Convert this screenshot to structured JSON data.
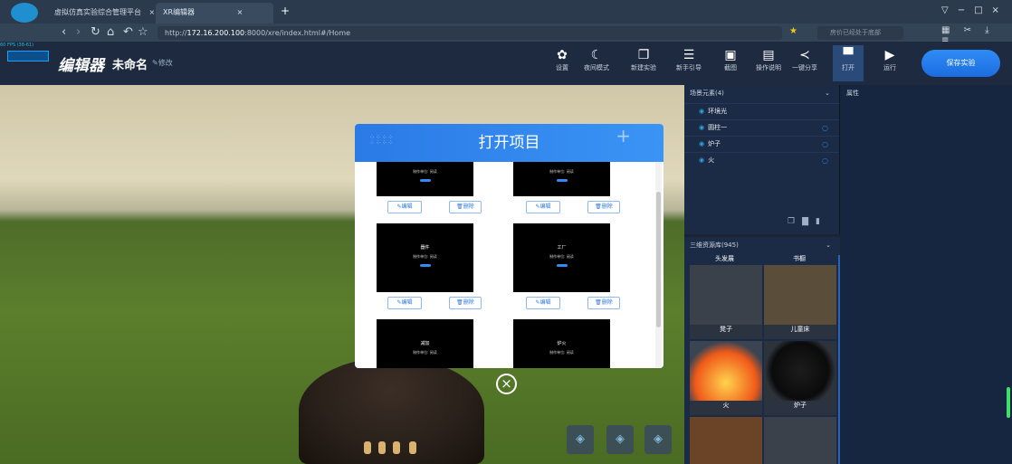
{
  "browser": {
    "tabs": [
      {
        "label": "虚拟仿真实验综合管理平台",
        "close": "×"
      },
      {
        "label": "XR编辑器",
        "close": "×"
      }
    ],
    "new_tab": "+",
    "window_controls": [
      "▽",
      "−",
      "□",
      "×"
    ],
    "url_prefix": "http://",
    "url_host": "172.16.200.100",
    "url_rest": ":8000/xre/index.html#/Home",
    "search_placeholder": "房价已经处于底部"
  },
  "app": {
    "fps": "60 FPS (38-61)",
    "logo": "编辑器",
    "project_name": "未命名",
    "modify_label": "修改",
    "toolbar": [
      {
        "label": "设置",
        "icon": "gear-icon"
      },
      {
        "label": "夜间模式",
        "icon": "moon-icon"
      },
      {
        "label": "新建实验",
        "icon": "new-icon"
      },
      {
        "label": "新手引导",
        "icon": "guide-icon"
      },
      {
        "label": "截图",
        "icon": "image-icon"
      },
      {
        "label": "操作说明",
        "icon": "doc-icon"
      },
      {
        "label": "一键分享",
        "icon": "share-icon"
      },
      {
        "label": "打开",
        "icon": "folder-icon"
      },
      {
        "label": "运行",
        "icon": "play-icon"
      }
    ],
    "save_label": "保存实验"
  },
  "modal": {
    "title": "打开项目",
    "cards": [
      {
        "title": "",
        "sub": "制作单位: 阅读"
      },
      {
        "title": "",
        "sub": "制作单位: 阅读"
      },
      {
        "title": "器件",
        "sub": "制作单位: 阅读"
      },
      {
        "title": "工厂",
        "sub": "制作单位: 阅读"
      },
      {
        "title": "减加",
        "sub": "制作单位: 阅读"
      },
      {
        "title": "炉火",
        "sub": "制作单位: 阅读"
      }
    ],
    "edit_label": "编辑",
    "delete_label": "删除"
  },
  "scene_panel": {
    "title": "场景元素(4)",
    "items": [
      "环境光",
      "圆柱一",
      "炉子",
      "火"
    ]
  },
  "resource_panel": {
    "title": "三维资源库(945)",
    "top_labels": [
      "头发展",
      "书橱"
    ],
    "items": [
      "凳子",
      "儿童床",
      "火",
      "炉子"
    ]
  },
  "props_panel": {
    "title": "属性"
  }
}
